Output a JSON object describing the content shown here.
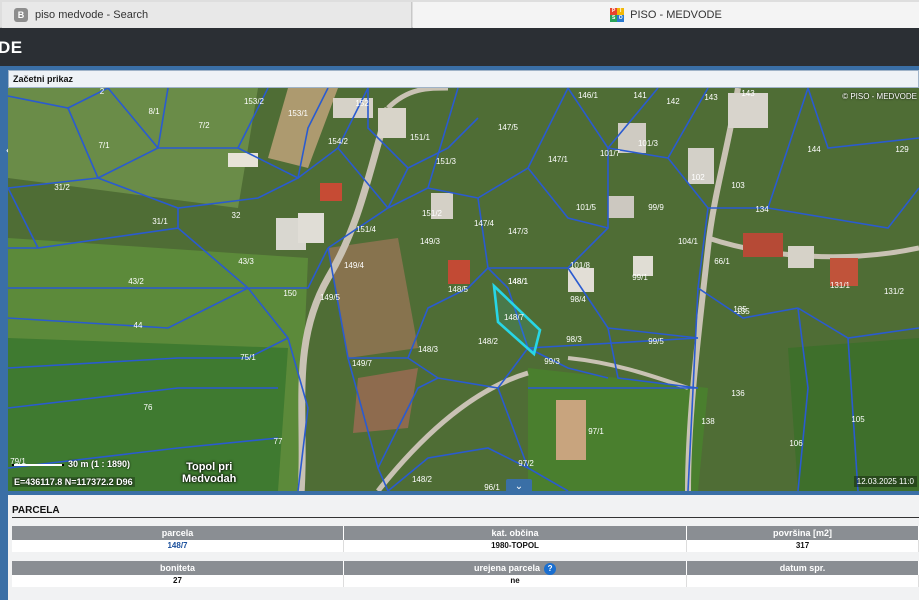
{
  "browser": {
    "tabs": [
      {
        "label": "piso medvode - Search",
        "favicon": "B"
      },
      {
        "label": "PISO - MEDVODE",
        "favicon": "PISO-logo"
      }
    ]
  },
  "header": {
    "title": "DE"
  },
  "panel": {
    "title": "Začetni prikaz"
  },
  "map": {
    "copyright": "© PISO - MEDVODE",
    "date": "12.03.2025 11:0",
    "scale": "30 m   (1 : 1890)",
    "coords": "E=436117.8    N=117372.2    D96",
    "place_line1": "Topol pri",
    "place_line2": "Medvodah",
    "parcel_labels": [
      "148/1",
      "146/1",
      "141",
      "142",
      "143",
      "153/2",
      "153/1",
      "152",
      "147/5",
      "101/3",
      "101/7",
      "144",
      "129",
      "151/1",
      "147/1",
      "102",
      "103",
      "8/1",
      "7/2",
      "154/2",
      "151/3",
      "151/2",
      "101/5",
      "99/9",
      "134",
      "31/2",
      "32",
      "147/4",
      "147/3",
      "104/1",
      "66/1",
      "31/1",
      "151/4",
      "149/3",
      "101/8",
      "99/1",
      "131/1",
      "131/2",
      "43/3",
      "149/4",
      "148/1",
      "43/2",
      "150",
      "149/5",
      "148/5",
      "98/4",
      "135",
      "44",
      "148/7",
      "98/3",
      "99/5",
      "148/3",
      "148/2",
      "149/7",
      "75/1",
      "99/3",
      "136",
      "76",
      "97/1",
      "105",
      "77",
      "106",
      "79/1",
      "97/2",
      "148/2",
      "7/1",
      "2",
      "96/1",
      "135",
      "138",
      "143"
    ],
    "boundary_color": "#2a5bd0",
    "highlight_color": "#27d6e6"
  },
  "parcela": {
    "title": "PARCELA",
    "headers1": [
      "parcela",
      "kat. občina",
      "površina [m2]"
    ],
    "values1": [
      "148/7",
      "1980-TOPOL",
      "317"
    ],
    "headers2": [
      "boniteta",
      "urejena parcela",
      "datum spr."
    ],
    "values2": [
      "27",
      "ne",
      ""
    ]
  }
}
